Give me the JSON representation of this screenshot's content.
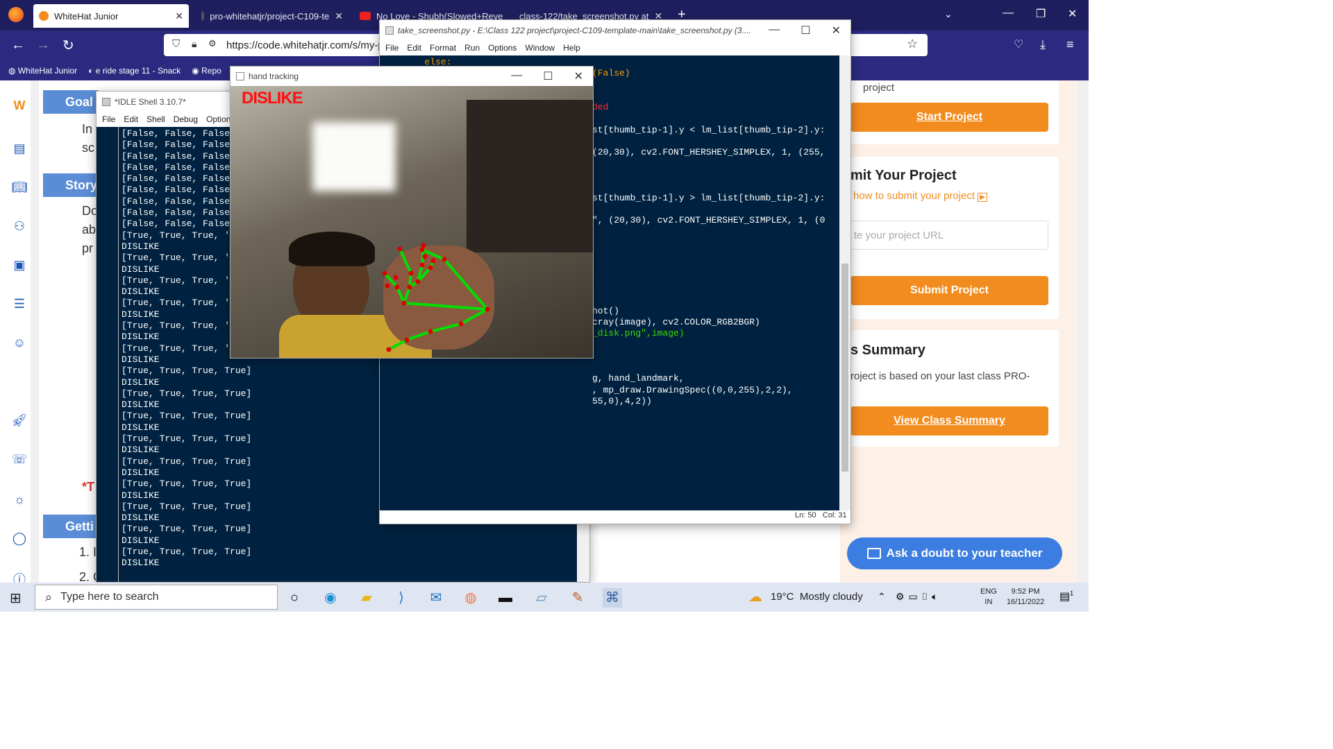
{
  "browser": {
    "tabs": [
      {
        "label": "WhiteHat Junior",
        "active": true
      },
      {
        "label": "pro-whitehatjr/project-C109-te"
      },
      {
        "label": "No Love - Shubh(Slowed+Reve"
      },
      {
        "label": "class-122/take_screenshot.py at"
      }
    ],
    "url": "https://code.whitehatjr.com/s/my-p",
    "bookmarks": [
      "WhiteHat Junior",
      "e ride stage 11 - Snack",
      "Repo"
    ]
  },
  "page": {
    "left_headings": [
      "Goal",
      "Story",
      "Getti"
    ],
    "left_snippets": [
      "In",
      "sc",
      "Do",
      "ab",
      "pr",
      "*T",
      "1. I",
      "2. C"
    ],
    "right": {
      "project_text": "project",
      "start_button": "Start Project",
      "submit_heading": "mit Your Project",
      "submit_link": "how to submit your project",
      "url_placeholder": "te your project URL",
      "submit_button": "Submit Project",
      "summary_heading": "s Summary",
      "summary_text": "roject is based on your last class PRO-",
      "summary_button": "View Class Summary",
      "doubt_button": "Ask a doubt to your teacher"
    }
  },
  "idle_shell": {
    "title": "*IDLE Shell 3.10.7*",
    "menu": [
      "File",
      "Edit",
      "Shell",
      "Debug",
      "Options"
    ],
    "lines": [
      "[False, False, False",
      "[False, False, False",
      "[False, False, False",
      "[False, False, False",
      "[False, False, False",
      "[False, False, False",
      "[False, False, False",
      "[False, False, False",
      "[False, False, False",
      "[True, True, True, '",
      "DISLIKE",
      "[True, True, True, '",
      "DISLIKE",
      "[True, True, True, '",
      "DISLIKE",
      "[True, True, True, '",
      "DISLIKE",
      "[True, True, True, '",
      "DISLIKE",
      "[True, True, True, '",
      "DISLIKE",
      "[True, True, True, True]",
      "DISLIKE",
      "[True, True, True, True]",
      "DISLIKE",
      "[True, True, True, True]",
      "DISLIKE",
      "[True, True, True, True]",
      "DISLIKE",
      "[True, True, True, True]",
      "DISLIKE",
      "[True, True, True, True]",
      "DISLIKE",
      "[True, True, True, True]",
      "DISLIKE",
      "[True, True, True, True]",
      "DISLIKE",
      "[True, True, True, True]",
      "DISLIKE"
    ]
  },
  "editor": {
    "title": "take_screenshot.py - E:\\Class 122 project\\project-C109-template-main\\take_screenshot.py (3....",
    "menu": [
      "File",
      "Edit",
      "Format",
      "Run",
      "Options",
      "Window",
      "Help"
    ],
    "lines": [
      {
        "text": "        else:",
        "color": "#ff9d00"
      },
      {
        "text": "(False)",
        "color": "#ff9d00"
      },
      {
        "text": "",
        "color": "#fff"
      },
      {
        "text": "",
        "color": "#fff"
      },
      {
        "text": "ded",
        "color": "#ff3030"
      },
      {
        "text": "",
        "color": "#fff"
      },
      {
        "text": "st[thumb_tip-1].y < lm_list[thumb_tip-2].y:",
        "color": "#fff"
      },
      {
        "text": "",
        "color": "#fff"
      },
      {
        "text": "(20,30), cv2.FONT_HERSHEY_SIMPLEX, 1, (255,",
        "color": "#fff"
      },
      {
        "text": "",
        "color": "#fff"
      },
      {
        "text": "",
        "color": "#fff"
      },
      {
        "text": "",
        "color": "#fff"
      },
      {
        "text": "st[thumb_tip-1].y > lm_list[thumb_tip-2].y:",
        "color": "#fff"
      },
      {
        "text": "",
        "color": "#fff"
      },
      {
        "text": "\", (20,30), cv2.FONT_HERSHEY_SIMPLEX, 1, (0",
        "color": "#fff"
      },
      {
        "text": "",
        "color": "#fff"
      },
      {
        "text": "",
        "color": "#fff"
      },
      {
        "text": "",
        "color": "#fff"
      },
      {
        "text": "",
        "color": "#fff"
      },
      {
        "text": "",
        "color": "#fff"
      },
      {
        "text": "",
        "color": "#fff"
      },
      {
        "text": "",
        "color": "#fff"
      },
      {
        "text": "hot()",
        "color": "#fff"
      },
      {
        "text": "cray(image), cv2.COLOR_RGB2BGR)",
        "color": "#fff"
      },
      {
        "text": "_disk.png\",image)",
        "color": "#3ad900"
      },
      {
        "text": "",
        "color": "#fff"
      },
      {
        "text": "",
        "color": "#fff"
      },
      {
        "text": "",
        "color": "#fff"
      },
      {
        "text": "g, hand_landmark,",
        "color": "#fff"
      },
      {
        "text": ", mp_draw.DrawingSpec((0,0,255),2,2),",
        "color": "#fff"
      },
      {
        "text": "55,0),4,2))",
        "color": "#fff"
      }
    ],
    "status": "Ln: 50   Col: 31"
  },
  "cv_window": {
    "title": "hand tracking",
    "label": "DISLIKE"
  },
  "taskbar": {
    "search_placeholder": "Type here to search",
    "weather": "19°C  Mostly cloudy",
    "lang": "ENG",
    "region": "IN",
    "time": "9:52 PM",
    "date": "16/11/2022",
    "notif_count": "1"
  }
}
